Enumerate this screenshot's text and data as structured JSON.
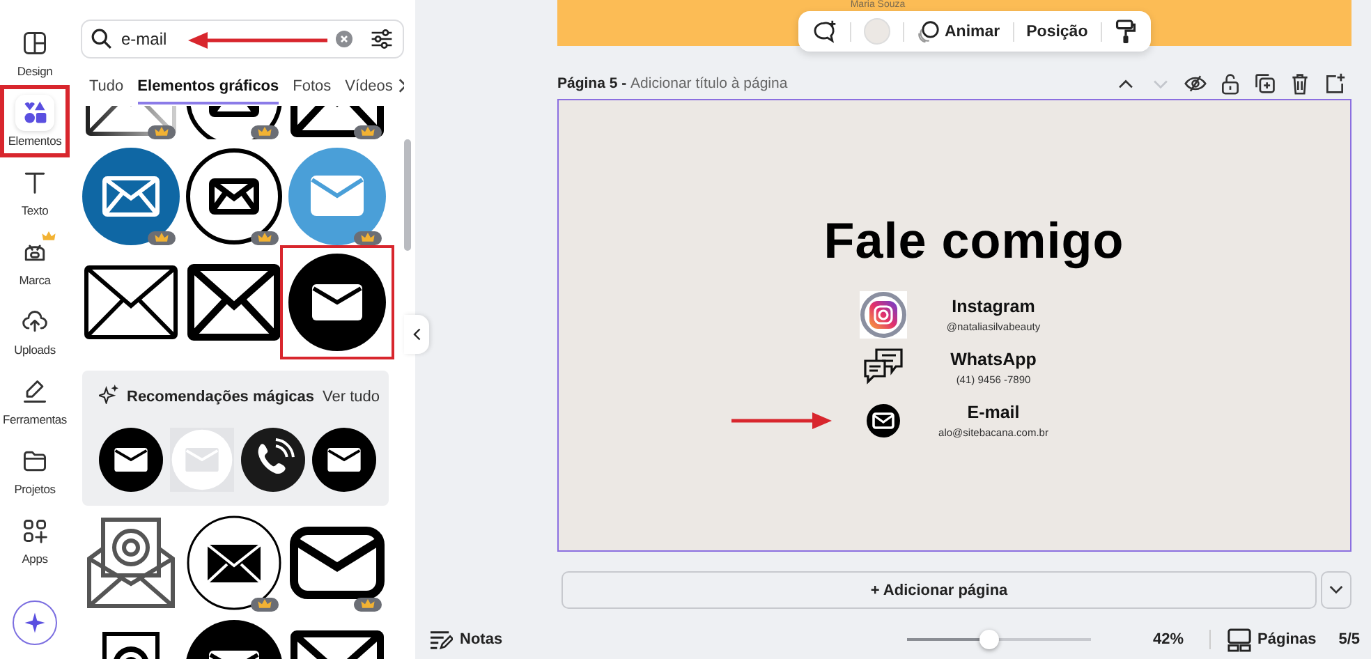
{
  "sidebar": {
    "items": [
      {
        "label": "Design",
        "selected": false,
        "highlighted": false,
        "premium": false
      },
      {
        "label": "Elementos",
        "selected": true,
        "highlighted": true,
        "premium": false
      },
      {
        "label": "Texto",
        "selected": false,
        "highlighted": false,
        "premium": false
      },
      {
        "label": "Marca",
        "selected": false,
        "highlighted": false,
        "premium": true
      },
      {
        "label": "Uploads",
        "selected": false,
        "highlighted": false,
        "premium": false
      },
      {
        "label": "Ferramentas",
        "selected": false,
        "highlighted": false,
        "premium": false
      },
      {
        "label": "Projetos",
        "selected": false,
        "highlighted": false,
        "premium": false
      },
      {
        "label": "Apps",
        "selected": false,
        "highlighted": false,
        "premium": false
      }
    ]
  },
  "search": {
    "value": "e-mail",
    "pointed": true
  },
  "tabs": [
    {
      "label": "Tudo",
      "selected": false
    },
    {
      "label": "Elementos gráficos",
      "selected": true
    },
    {
      "label": "Fotos",
      "selected": false
    },
    {
      "label": "Vídeos",
      "selected": false
    }
  ],
  "results": {
    "rows_above": [
      [
        {
          "kind": "gray-outline",
          "premium": true,
          "highlighted": false
        },
        {
          "kind": "ring",
          "premium": true,
          "highlighted": false
        },
        {
          "kind": "outline-thick",
          "premium": true,
          "highlighted": false
        }
      ],
      [
        {
          "kind": "blue-disc",
          "premium": true,
          "highlighted": false
        },
        {
          "kind": "ring",
          "premium": true,
          "highlighted": false
        },
        {
          "kind": "sky-disc",
          "premium": true,
          "highlighted": false
        }
      ],
      [
        {
          "kind": "outline",
          "premium": false,
          "highlighted": false
        },
        {
          "kind": "outline-thick",
          "premium": false,
          "highlighted": false
        },
        {
          "kind": "black-disc",
          "premium": false,
          "highlighted": true
        }
      ]
    ],
    "recommendations": {
      "title": "Recomendações mágicas",
      "link": "Ver tudo",
      "items": [
        {
          "kind": "black-disc"
        },
        {
          "kind": "faded-disc"
        },
        {
          "kind": "phone-disc"
        },
        {
          "kind": "black-disc"
        }
      ]
    },
    "rows_below": [
      [
        {
          "kind": "open-at",
          "premium": false,
          "highlighted": false
        },
        {
          "kind": "ring-filled",
          "premium": true,
          "highlighted": false
        },
        {
          "kind": "rounded-thick",
          "premium": true,
          "highlighted": false
        }
      ],
      [
        {
          "kind": "letter-at",
          "highlighted": false
        },
        {
          "kind": "black-disc",
          "highlighted": false
        },
        {
          "kind": "outline-thick",
          "highlighted": false
        }
      ]
    ]
  },
  "page_top": {
    "caption": "Maria Souza"
  },
  "toolbar": {
    "items": [
      {
        "kind": "comment"
      },
      {
        "kind": "swatch"
      },
      {
        "kind": "animate",
        "label": "Animar"
      },
      {
        "kind": "text",
        "label": "Posição"
      },
      {
        "kind": "roller"
      }
    ]
  },
  "page": {
    "number": "Página 5 -",
    "title_placeholder": "Adicionar título à página",
    "actions": [
      {
        "kind": "up",
        "disabled": false
      },
      {
        "kind": "down",
        "disabled": true
      },
      {
        "kind": "hide",
        "disabled": false
      },
      {
        "kind": "lock",
        "disabled": false
      },
      {
        "kind": "duplicate",
        "disabled": false
      },
      {
        "kind": "delete",
        "disabled": false
      },
      {
        "kind": "add",
        "disabled": false
      }
    ]
  },
  "design": {
    "heading": "Fale comigo",
    "contacts": [
      {
        "kind": "instagram",
        "name": "Instagram",
        "detail": "@nataliasilvabeauty",
        "pointed": false
      },
      {
        "kind": "chat",
        "name": "WhatsApp",
        "detail": "(41) 9456 -7890",
        "pointed": false
      },
      {
        "kind": "mail",
        "name": "E-mail",
        "detail": "alo@sitebacana.com.br",
        "pointed": true
      }
    ]
  },
  "add_page": {
    "label": "+ Adicionar página"
  },
  "status_bar": {
    "notes": "Notas",
    "zoom": {
      "level": 0.44,
      "reading": "42%"
    },
    "pages": "Páginas",
    "count": "5/5"
  }
}
